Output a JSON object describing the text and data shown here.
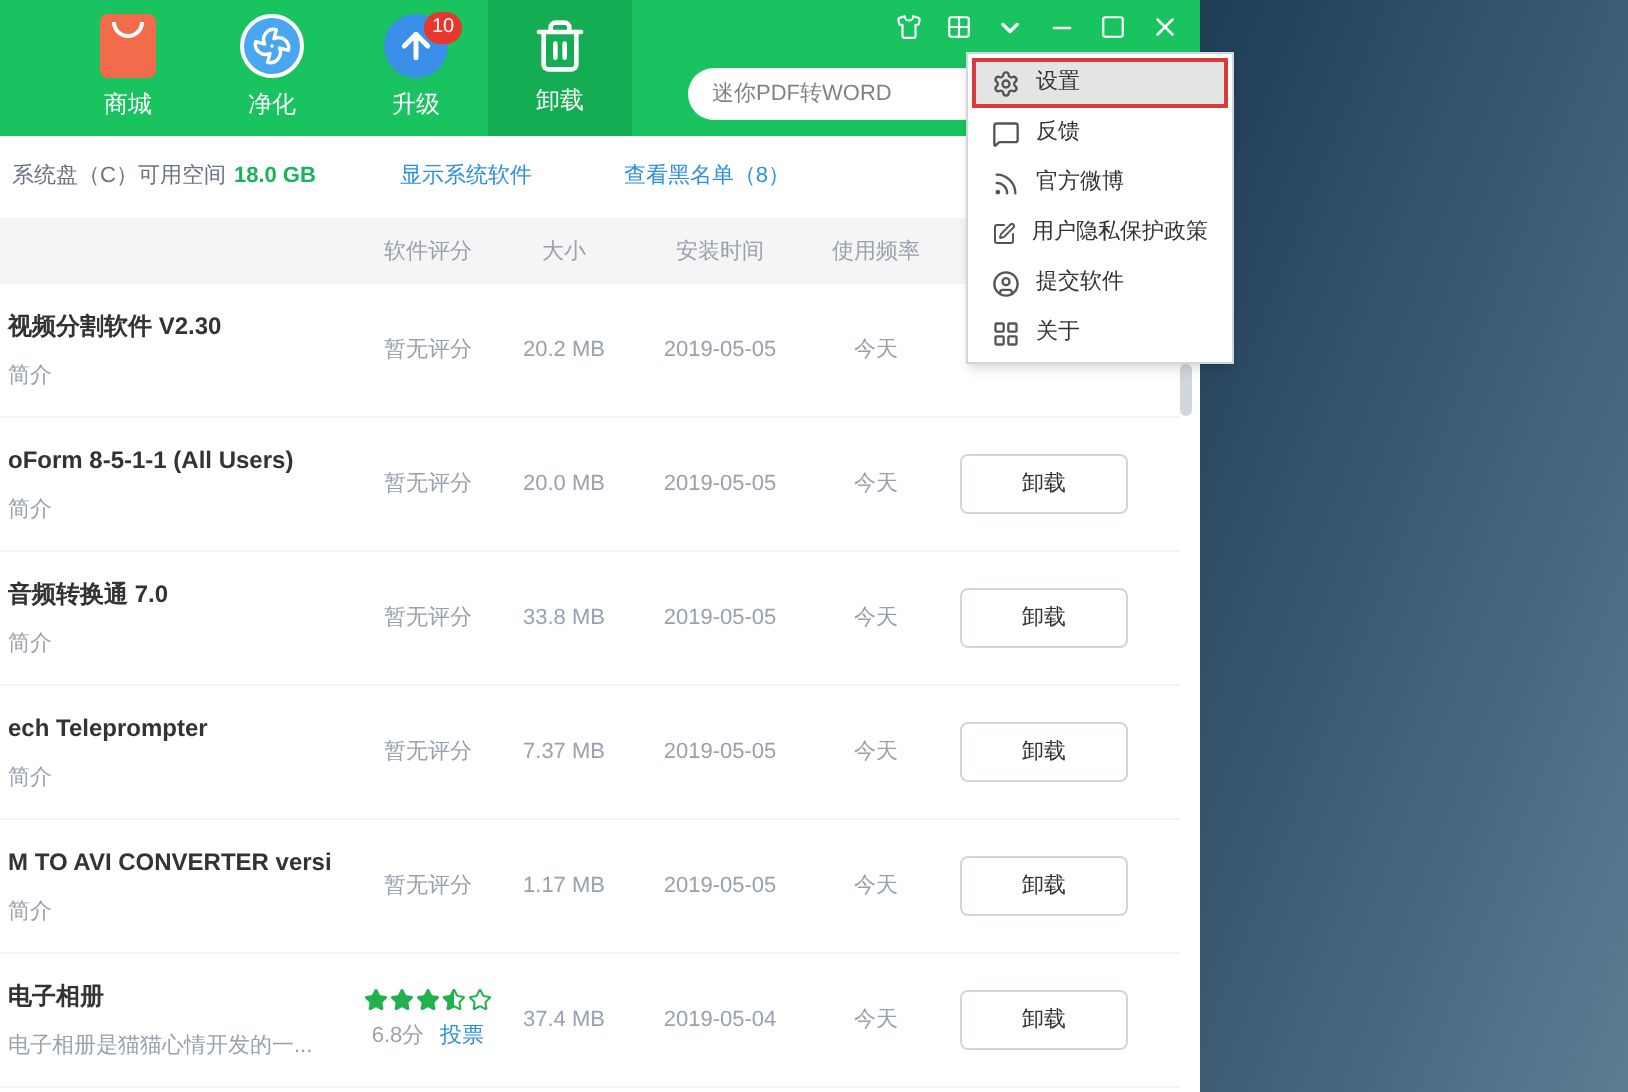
{
  "nav_tabs": [
    {
      "label": "商城",
      "selected": false
    },
    {
      "label": "净化",
      "selected": false
    },
    {
      "label": "升级",
      "selected": false,
      "badge": "10"
    },
    {
      "label": "卸载",
      "selected": true
    }
  ],
  "search": {
    "placeholder": "迷你PDF转WORD"
  },
  "info_bar": {
    "disk_label": "系统盘（C）可用空间",
    "disk_free": "18.0 GB",
    "show_system_link": "显示系统软件",
    "blacklist_link": "查看黑名单（8）"
  },
  "table": {
    "columns": [
      "软件评分",
      "大小",
      "安装时间",
      "使用频率"
    ],
    "rows": [
      {
        "name": "视频分割软件 V2.30",
        "desc": "简介",
        "rating": "暂无评分",
        "size": "20.2 MB",
        "installed": "2019-05-05",
        "usage": "今天"
      },
      {
        "name": "oForm 8-5-1-1 (All Users)",
        "desc": "简介",
        "rating": "暂无评分",
        "size": "20.0 MB",
        "installed": "2019-05-05",
        "usage": "今天",
        "button": "卸载"
      },
      {
        "name": "音频转换通 7.0",
        "desc": "简介",
        "rating": "暂无评分",
        "size": "33.8 MB",
        "installed": "2019-05-05",
        "usage": "今天",
        "button": "卸载"
      },
      {
        "name": "ech Teleprompter",
        "desc": "简介",
        "rating": "暂无评分",
        "size": "7.37 MB",
        "installed": "2019-05-05",
        "usage": "今天",
        "button": "卸载"
      },
      {
        "name": "M TO AVI CONVERTER versi",
        "desc": "简介",
        "rating": "暂无评分",
        "size": "1.17 MB",
        "installed": "2019-05-05",
        "usage": "今天",
        "button": "卸载"
      },
      {
        "name": "电子相册",
        "desc": "电子相册是猫猫心情开发的一...",
        "stars": 3.5,
        "score": "6.8分",
        "vote": "投票",
        "size": "37.4 MB",
        "installed": "2019-05-04",
        "usage": "今天",
        "button": "卸载"
      }
    ]
  },
  "menu": [
    {
      "label": "设置",
      "selected": true
    },
    {
      "label": "反馈",
      "selected": false
    },
    {
      "label": "官方微博",
      "selected": false
    },
    {
      "label": "用户隐私保护政策",
      "selected": false
    },
    {
      "label": "提交软件",
      "selected": false
    },
    {
      "label": "关于",
      "selected": false
    }
  ]
}
